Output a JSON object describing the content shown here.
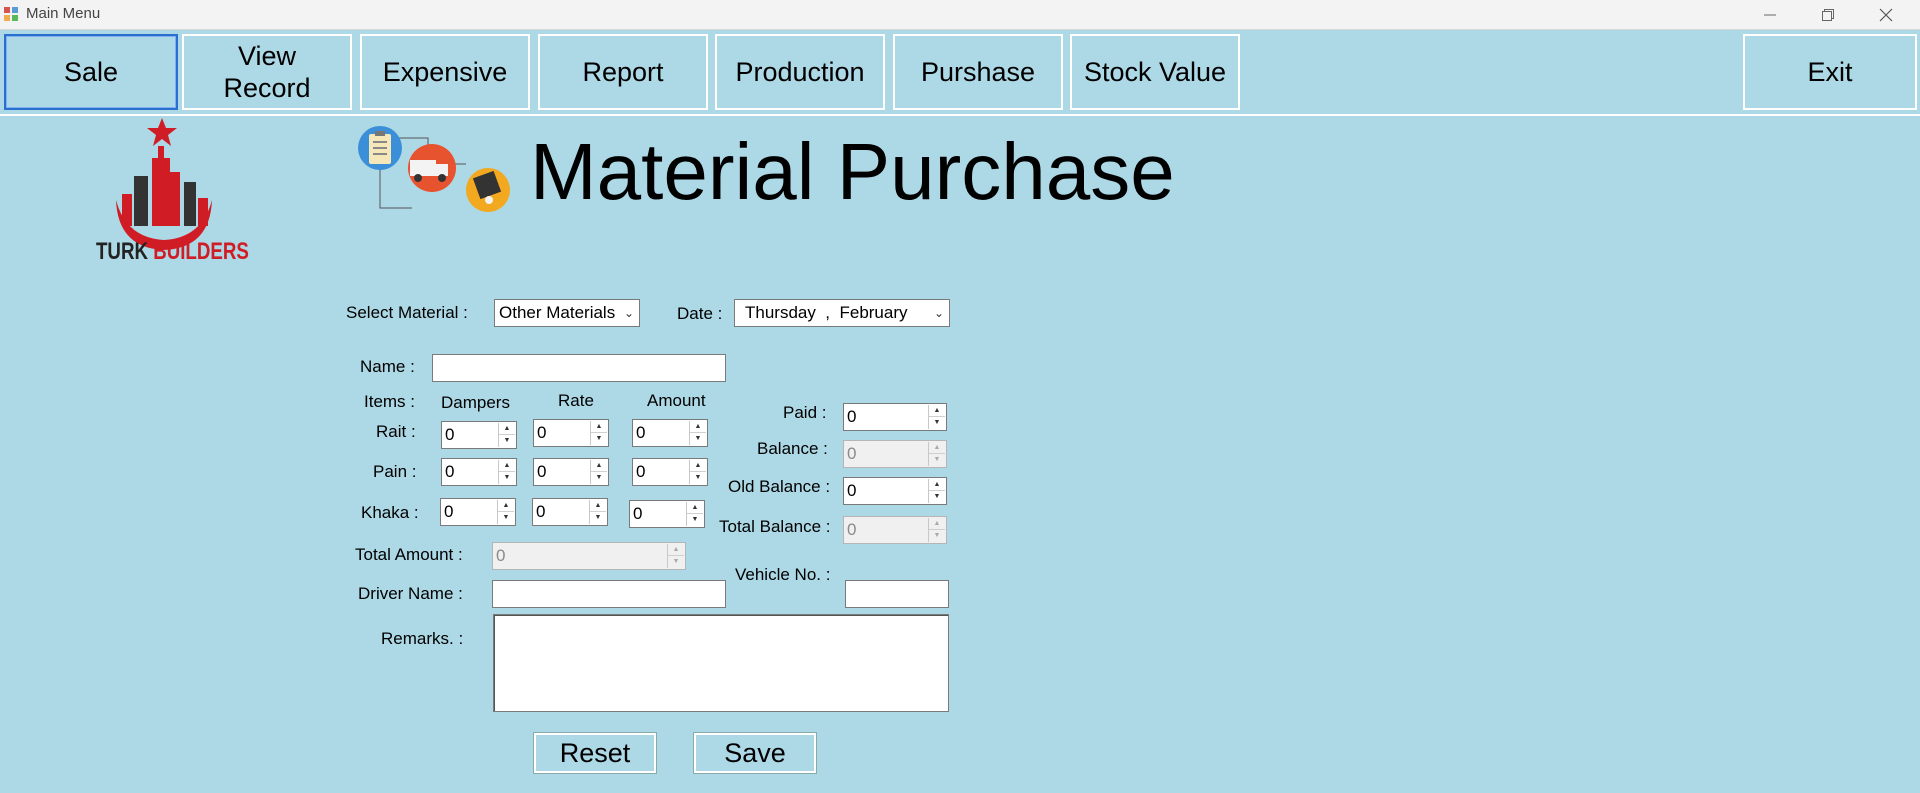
{
  "window": {
    "title": "Main Menu"
  },
  "menu": {
    "sale": "Sale",
    "view_record": "View\nRecord",
    "expensive": "Expensive",
    "report": "Report",
    "production": "Production",
    "purshase": "Purshase",
    "stock_value": "Stock Value",
    "exit": "Exit"
  },
  "logo": {
    "text_dark": "TURK",
    "text_red": "BUILDERS"
  },
  "page": {
    "title": "Material Purchase"
  },
  "form": {
    "select_material_label": "Select Material :",
    "select_material_value": "Other Materials",
    "date_label": "Date :",
    "date_value": "Thursday  ,  February",
    "name_label": "Name :",
    "name_value": "",
    "items_label": "Items :",
    "col_dampers": "Dampers",
    "col_rate": "Rate",
    "col_amount": "Amount",
    "rows": [
      {
        "label": "Rait :",
        "dampers": "0",
        "rate": "0",
        "amount": "0"
      },
      {
        "label": "Pain :",
        "dampers": "0",
        "rate": "0",
        "amount": "0"
      },
      {
        "label": "Khaka :",
        "dampers": "0",
        "rate": "0",
        "amount": "0"
      }
    ],
    "paid_label": "Paid :",
    "paid_value": "0",
    "balance_label": "Balance :",
    "balance_value": "0",
    "old_balance_label": "Old Balance :",
    "old_balance_value": "0",
    "total_balance_label": "Total Balance :",
    "total_balance_value": "0",
    "total_amount_label": "Total Amount :",
    "total_amount_value": "0",
    "vehicle_label": "Vehicle No. :",
    "vehicle_value": "",
    "driver_label": "Driver Name :",
    "driver_value": "",
    "remarks_label": "Remarks. :",
    "remarks_value": ""
  },
  "actions": {
    "reset": "Reset",
    "save": "Save"
  }
}
